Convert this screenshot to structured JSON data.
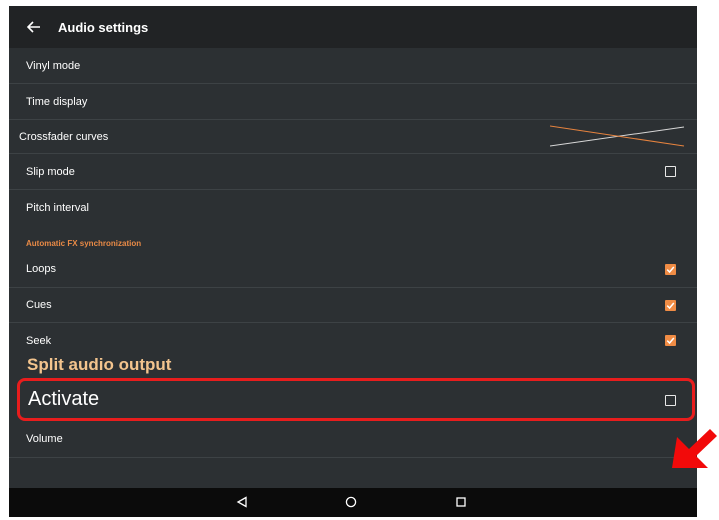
{
  "appbar": {
    "title": "Audio settings",
    "back_icon": "arrow-left-icon"
  },
  "rows": {
    "vinyl_mode": "Vinyl mode",
    "time_display": "Time display",
    "crossfader_curves": "Crossfader curves",
    "slip_mode": "Slip mode",
    "pitch_interval": "Pitch interval",
    "loops": "Loops",
    "cues": "Cues",
    "seek": "Seek",
    "activate": "Activate",
    "volume": "Volume"
  },
  "checkboxes": {
    "slip_mode": false,
    "loops": true,
    "cues": true,
    "seek": true,
    "activate": false
  },
  "section": {
    "automatic_fx": "Automatic FX synchronization"
  },
  "annotation": {
    "split_audio_output": "Split audio output"
  },
  "colors": {
    "accent": "#f08c45",
    "highlight": "#e81d1d",
    "background": "#2c3033",
    "appbar": "#212325"
  },
  "navbar": {
    "icons": [
      "back-triangle-icon",
      "home-circle-icon",
      "recents-square-icon"
    ]
  }
}
